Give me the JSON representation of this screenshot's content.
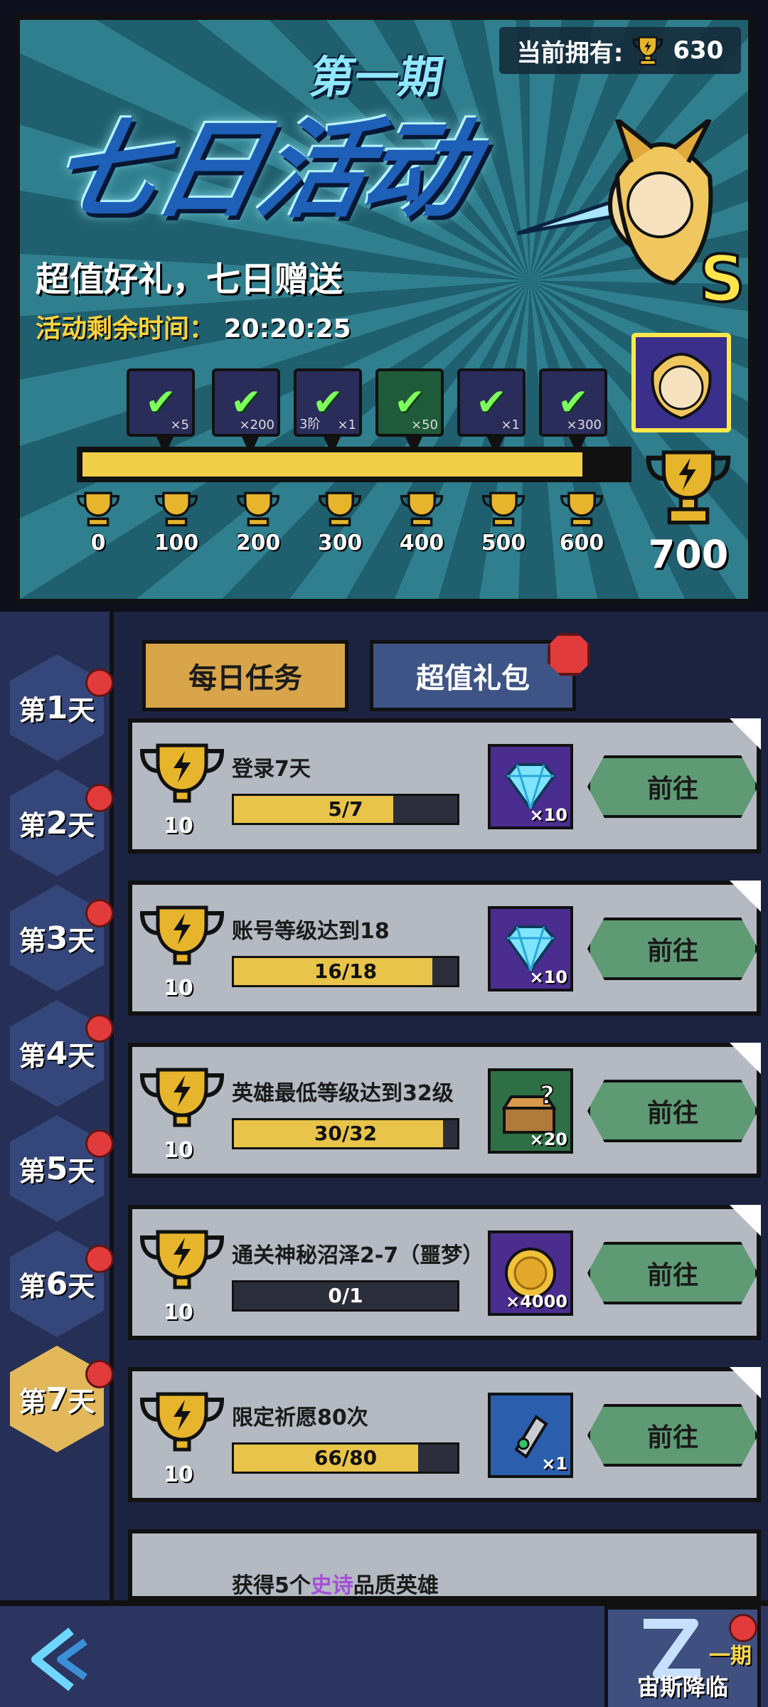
{
  "banner": {
    "owned_label": "当前拥有:",
    "owned_value": "630",
    "period": "第一期",
    "main_title": "七日活动",
    "subtitle": "超值好礼，七日赠送",
    "countdown_label": "活动剩余时间：",
    "countdown_value": "20:20:25",
    "hero_rank": "S",
    "progress": 0.92,
    "rewards": [
      {
        "qty": "×5",
        "tier": "",
        "claimed": true,
        "icon": "chest-icon"
      },
      {
        "qty": "×200",
        "tier": "",
        "claimed": true,
        "icon": "diamond-icon"
      },
      {
        "qty": "×1",
        "tier": "3阶",
        "claimed": true,
        "icon": "gear-piece-icon"
      },
      {
        "qty": "×50",
        "tier": "",
        "claimed": true,
        "icon": "gift-box-icon"
      },
      {
        "qty": "×1",
        "tier": "",
        "claimed": true,
        "icon": "mystery-chest-icon"
      },
      {
        "qty": "×300",
        "tier": "",
        "claimed": true,
        "icon": "diamond-icon"
      }
    ],
    "milestones": [
      "0",
      "100",
      "200",
      "300",
      "400",
      "500",
      "600"
    ],
    "final_goal": "700"
  },
  "days": [
    "第1天",
    "第2天",
    "第3天",
    "第4天",
    "第5天",
    "第6天",
    "第7天"
  ],
  "day_numbers": [
    "1",
    "2",
    "3",
    "4",
    "5",
    "6",
    "7"
  ],
  "day_char": "天",
  "day_prefix": "第",
  "active_day": 7,
  "tabs": {
    "daily": "每日任务",
    "gift": "超值礼包"
  },
  "tasks": [
    {
      "points": "10",
      "name": "登录7天",
      "progress_text": "5/7",
      "progress": 0.714,
      "item_qty": "×10",
      "item_icon": "diamond-icon",
      "button": "前往"
    },
    {
      "points": "10",
      "name": "账号等级达到18",
      "progress_text": "16/18",
      "progress": 0.889,
      "item_qty": "×10",
      "item_icon": "diamond-icon",
      "button": "前往"
    },
    {
      "points": "10",
      "name": "英雄最低等级达到32级",
      "progress_text": "30/32",
      "progress": 0.9375,
      "item_qty": "×20",
      "item_icon": "mystery-chest-icon",
      "button": "前往"
    },
    {
      "points": "10",
      "name": "通关神秘沼泽2-7（噩梦）",
      "progress_text": "0/1",
      "progress": 0,
      "item_qty": "×4000",
      "item_icon": "gold-coin-icon",
      "button": "前往"
    },
    {
      "points": "10",
      "name": "限定祈愿80次",
      "progress_text": "66/80",
      "progress": 0.825,
      "item_qty": "×1",
      "item_icon": "scroll-icon",
      "button": "前往"
    }
  ],
  "partial_task": {
    "prefix": "获得5个",
    "epic": "史诗",
    "suffix": "品质英雄"
  },
  "bottom": {
    "event_label": "宙斯降临",
    "event_period": "一期"
  },
  "colors": {
    "accent_gold": "#f2cf48",
    "go_green": "#5e9a74",
    "badge_red": "#e23b3b",
    "active_day": "#e2b85a"
  }
}
